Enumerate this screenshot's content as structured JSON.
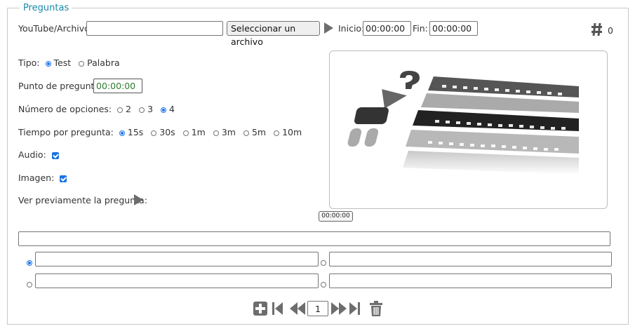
{
  "section": {
    "legend": "Preguntas"
  },
  "media": {
    "source_label": "YouTube/Archivo:",
    "source_value": "",
    "select_file_label": "Seleccionar un archivo",
    "start_label": "Inicio:",
    "start_value": "00:00:00",
    "end_label": "Fin:",
    "end_value": "00:00:00",
    "count_icon": "hash-icon",
    "count_value": "0"
  },
  "question": {
    "type_label": "Tipo:",
    "type_options": [
      {
        "label": "Test",
        "selected": true
      },
      {
        "label": "Palabra",
        "selected": false
      }
    ],
    "point_label": "Punto de pregunta:",
    "point_value": "00:00:00",
    "options_count_label": "Número de opciones:",
    "options_count_choices": [
      {
        "label": "2",
        "selected": false
      },
      {
        "label": "3",
        "selected": false
      },
      {
        "label": "4",
        "selected": true
      }
    ],
    "time_label": "Tiempo por pregunta:",
    "time_choices": [
      {
        "label": "15s",
        "selected": true
      },
      {
        "label": "30s",
        "selected": false
      },
      {
        "label": "1m",
        "selected": false
      },
      {
        "label": "3m",
        "selected": false
      },
      {
        "label": "5m",
        "selected": false
      },
      {
        "label": "10m",
        "selected": false
      }
    ],
    "audio_label": "Audio:",
    "audio_checked": true,
    "image_label": "Imagen:",
    "image_checked": true,
    "preview_label": "Ver previamente la pregunta:",
    "image_time": "00:00:00"
  },
  "answers": {
    "question_text": "",
    "options": [
      {
        "value": "",
        "correct": true
      },
      {
        "value": "",
        "correct": false
      },
      {
        "value": "",
        "correct": false
      },
      {
        "value": "",
        "correct": false
      }
    ]
  },
  "pager": {
    "current_page": "1"
  },
  "colors": {
    "accent": "#1a73e8",
    "legend": "#1a8aa8",
    "icon": "#6d6d6d"
  }
}
